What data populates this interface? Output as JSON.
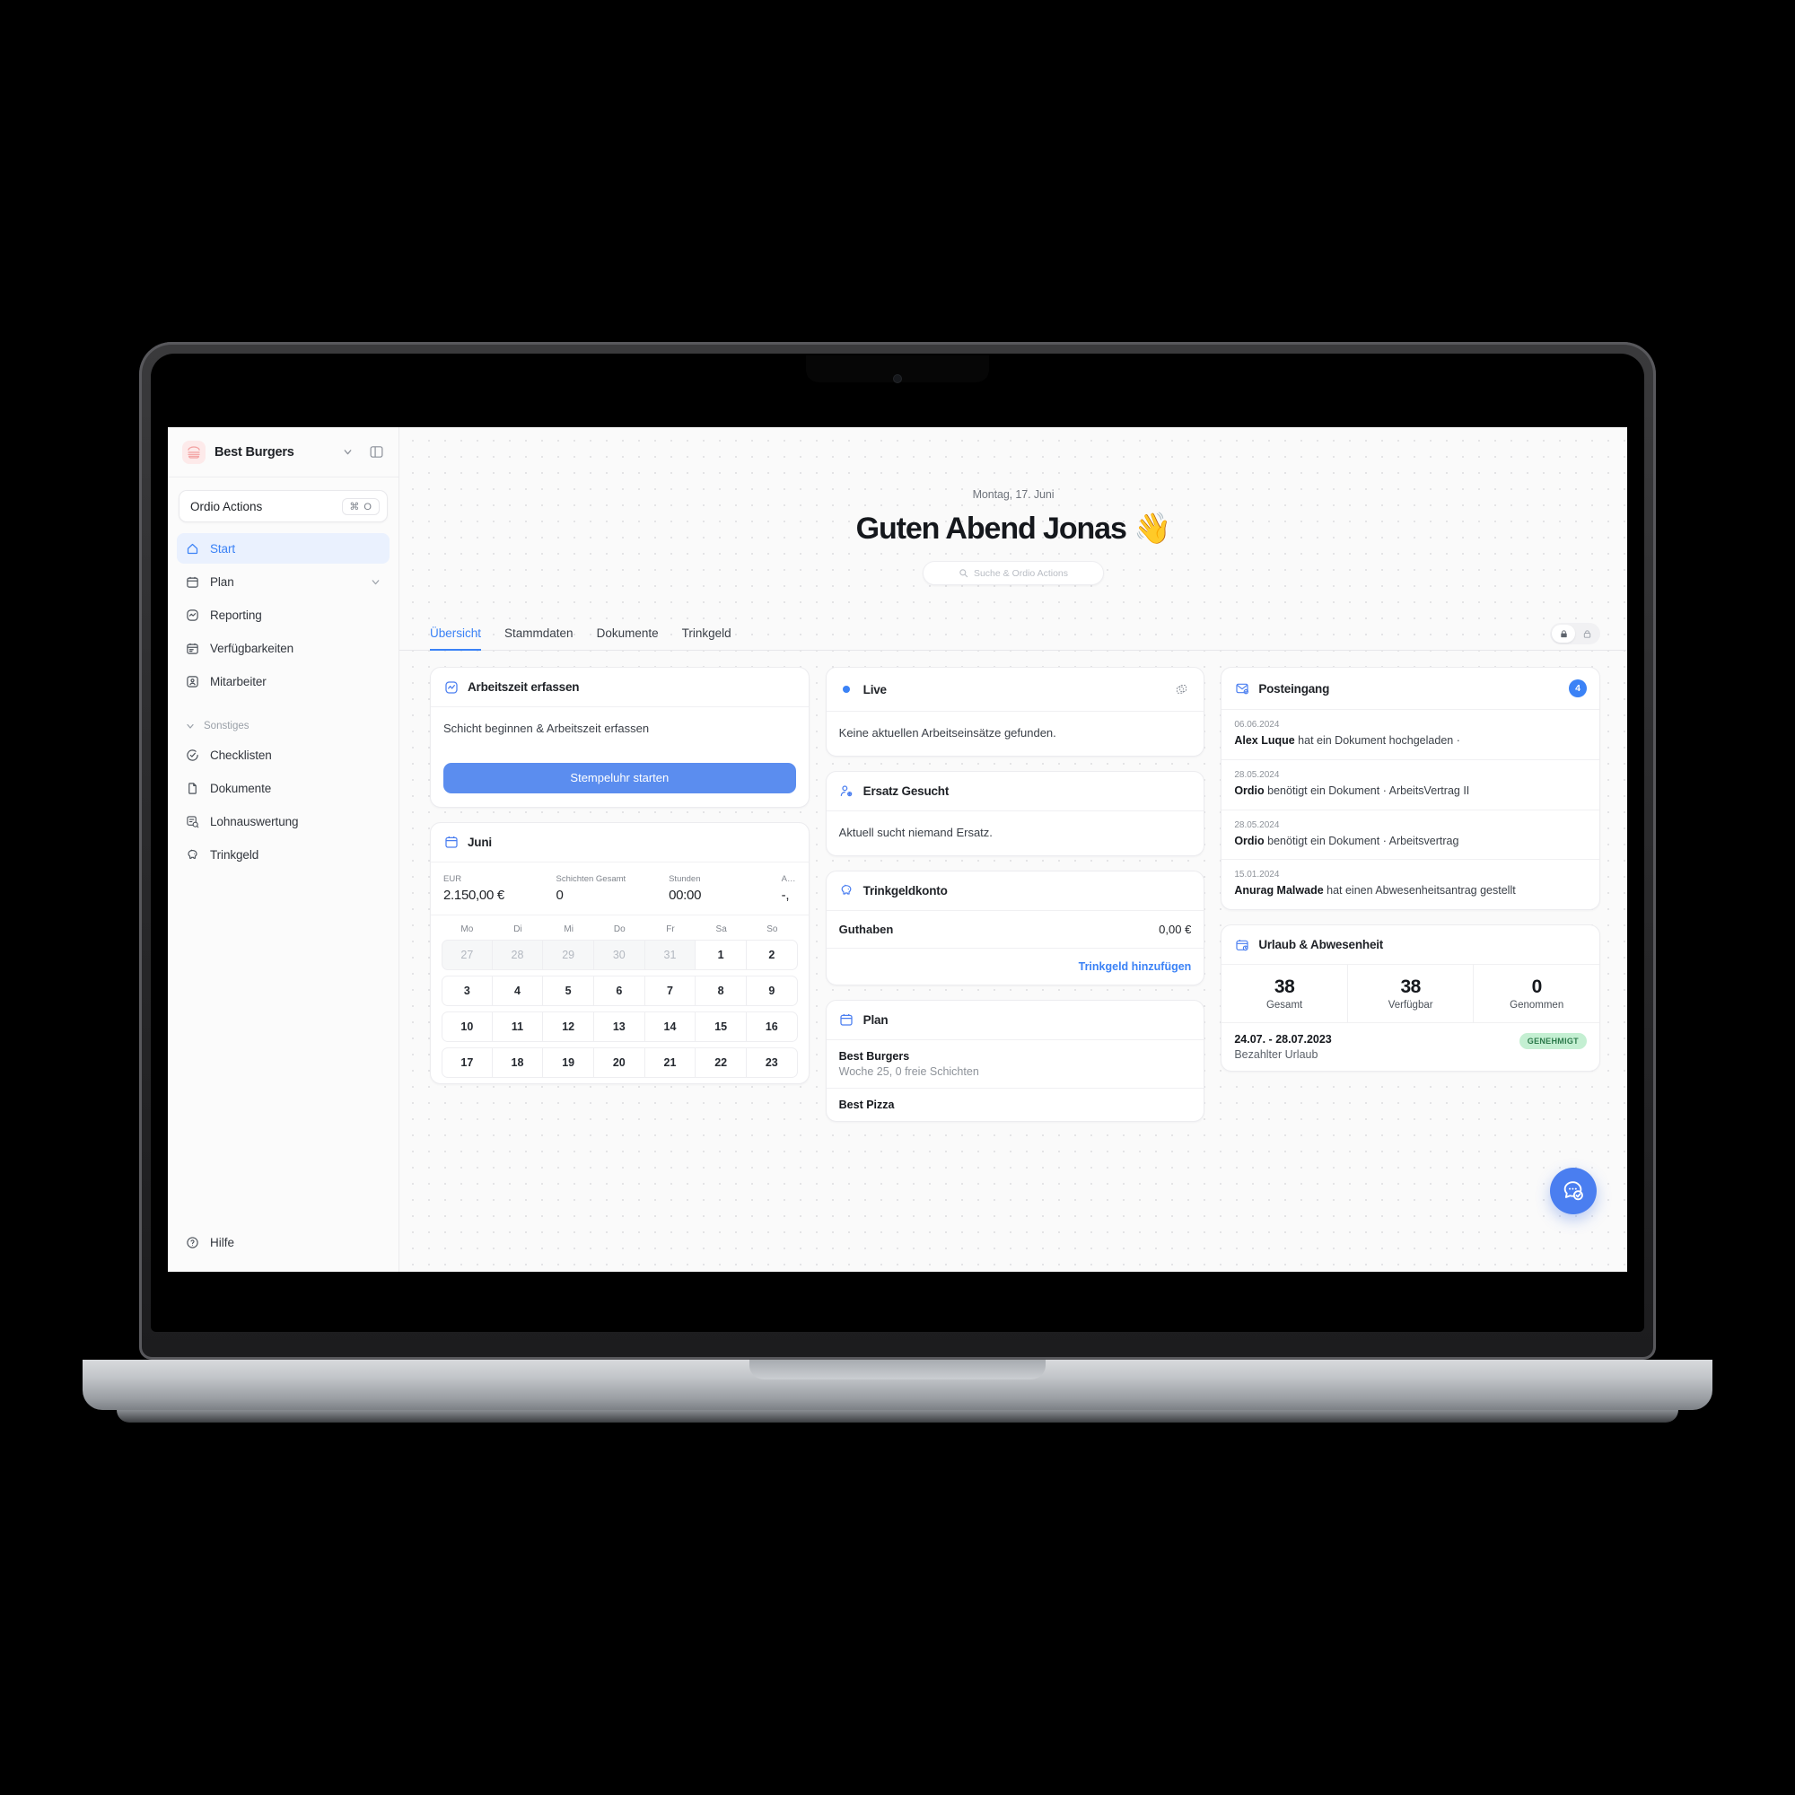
{
  "sidebar": {
    "org": {
      "name": "Best Burgers",
      "logo_icon": "burger-icon",
      "chevron_icon": "chevron-down-icon",
      "panel_icon": "panel-toggle-icon"
    },
    "search": {
      "label": "Ordio Actions",
      "shortcut": "⌘ O"
    },
    "items": [
      {
        "label": "Start",
        "icon": "home-icon",
        "active": true
      },
      {
        "label": "Plan",
        "icon": "calendar-icon",
        "active": false,
        "chevron": true
      },
      {
        "label": "Reporting",
        "icon": "activity-icon",
        "active": false
      },
      {
        "label": "Verfügbarkeiten",
        "icon": "calendar-check-icon",
        "active": false
      },
      {
        "label": "Mitarbeiter",
        "icon": "user-square-icon",
        "active": false
      }
    ],
    "group_label": "Sonstiges",
    "other_items": [
      {
        "label": "Checklisten",
        "icon": "check-circle-icon"
      },
      {
        "label": "Dokumente",
        "icon": "document-icon"
      },
      {
        "label": "Lohnauswertung",
        "icon": "payroll-icon"
      },
      {
        "label": "Trinkgeld",
        "icon": "piggy-bank-icon"
      }
    ],
    "help": {
      "label": "Hilfe",
      "icon": "question-circle-icon"
    }
  },
  "hero": {
    "date": "Montag, 17. Juni",
    "greeting": "Guten Abend Jonas 👋",
    "search_placeholder": "Suche & Ordio Actions",
    "search_icon": "search-icon"
  },
  "tabs": [
    {
      "label": "Übersicht",
      "active": true
    },
    {
      "label": "Stammdaten",
      "active": false
    },
    {
      "label": "Dokumente",
      "active": false
    },
    {
      "label": "Trinkgeld",
      "active": false
    }
  ],
  "segmented": [
    {
      "icon": "lock-filled-icon",
      "on": true
    },
    {
      "icon": "lock-outline-icon",
      "on": false
    }
  ],
  "time_card": {
    "title": "Arbeitszeit erfassen",
    "icon": "activity-square-icon",
    "description": "Schicht beginnen & Arbeitszeit erfassen",
    "button": "Stempeluhr starten"
  },
  "calendar_card": {
    "title": "Juni",
    "icon": "calendar-icon",
    "stats": [
      {
        "key": "EUR",
        "value": "2.150,00 €"
      },
      {
        "key": "Schichten Gesamt",
        "value": "0"
      },
      {
        "key": "Stunden",
        "value": "00:00"
      },
      {
        "key": "A…",
        "value": "-,"
      }
    ],
    "weekdays": [
      "Mo",
      "Di",
      "Mi",
      "Do",
      "Fr",
      "Sa",
      "So"
    ],
    "weeks": [
      [
        {
          "d": "27",
          "muted": true
        },
        {
          "d": "28",
          "muted": true
        },
        {
          "d": "29",
          "muted": true
        },
        {
          "d": "30",
          "muted": true
        },
        {
          "d": "31",
          "muted": true
        },
        {
          "d": "1",
          "muted": false
        },
        {
          "d": "2",
          "muted": false
        }
      ],
      [
        {
          "d": "3",
          "muted": false
        },
        {
          "d": "4",
          "muted": false
        },
        {
          "d": "5",
          "muted": false
        },
        {
          "d": "6",
          "muted": false
        },
        {
          "d": "7",
          "muted": false
        },
        {
          "d": "8",
          "muted": false
        },
        {
          "d": "9",
          "muted": false
        }
      ],
      [
        {
          "d": "10",
          "muted": false
        },
        {
          "d": "11",
          "muted": false
        },
        {
          "d": "12",
          "muted": false
        },
        {
          "d": "13",
          "muted": false
        },
        {
          "d": "14",
          "muted": false
        },
        {
          "d": "15",
          "muted": false
        },
        {
          "d": "16",
          "muted": false
        }
      ],
      [
        {
          "d": "17",
          "muted": false
        },
        {
          "d": "18",
          "muted": false
        },
        {
          "d": "19",
          "muted": false
        },
        {
          "d": "20",
          "muted": false
        },
        {
          "d": "21",
          "muted": false
        },
        {
          "d": "22",
          "muted": false
        },
        {
          "d": "23",
          "muted": false
        }
      ]
    ]
  },
  "live_card": {
    "title": "Live",
    "icon": "live-dot-icon",
    "action_icon": "expand-icon",
    "body": "Keine aktuellen Arbeitseinsätze gefunden."
  },
  "substitute_card": {
    "title": "Ersatz Gesucht",
    "icon": "user-swap-icon",
    "body": "Aktuell sucht niemand Ersatz."
  },
  "tip_card": {
    "title": "Trinkgeldkonto",
    "icon": "piggy-bank-icon",
    "balance_label": "Guthaben",
    "balance_value": "0,00 €",
    "link": "Trinkgeld hinzufügen"
  },
  "plan_card": {
    "title": "Plan",
    "icon": "calendar-icon",
    "items": [
      {
        "name": "Best Burgers",
        "sub": "Woche 25, 0 freie Schichten"
      },
      {
        "name": "Best Pizza",
        "sub": ""
      }
    ]
  },
  "inbox_card": {
    "title": "Posteingang",
    "icon": "inbox-mail-icon",
    "count": "4",
    "items": [
      {
        "date": "06.06.2024",
        "actor": "Alex Luque",
        "text": " hat ein Dokument hochgeladen ·"
      },
      {
        "date": "28.05.2024",
        "actor": "Ordio",
        "text": " benötigt ein Dokument · ArbeitsVertrag II"
      },
      {
        "date": "28.05.2024",
        "actor": "Ordio",
        "text": " benötigt ein Dokument · Arbeitsvertrag"
      },
      {
        "date": "15.01.2024",
        "actor": "Anurag Malwade",
        "text": " hat einen Abwesenheitsantrag gestellt"
      }
    ]
  },
  "vacation_card": {
    "title": "Urlaub & Abwesenheit",
    "icon": "calendar-clock-icon",
    "stats": [
      {
        "num": "38",
        "label": "Gesamt"
      },
      {
        "num": "38",
        "label": "Verfügbar"
      },
      {
        "num": "0",
        "label": "Genommen"
      }
    ],
    "entry": {
      "dates": "24.07. - 28.07.2023",
      "type": "Bezahlter Urlaub",
      "status": "GENEHMIGT"
    }
  },
  "fab": {
    "icon": "chat-check-icon"
  },
  "colors": {
    "accent": "#3b82f6",
    "button": "#5b8def",
    "pill_bg": "#c4efd2",
    "pill_text": "#2c7a4b"
  }
}
